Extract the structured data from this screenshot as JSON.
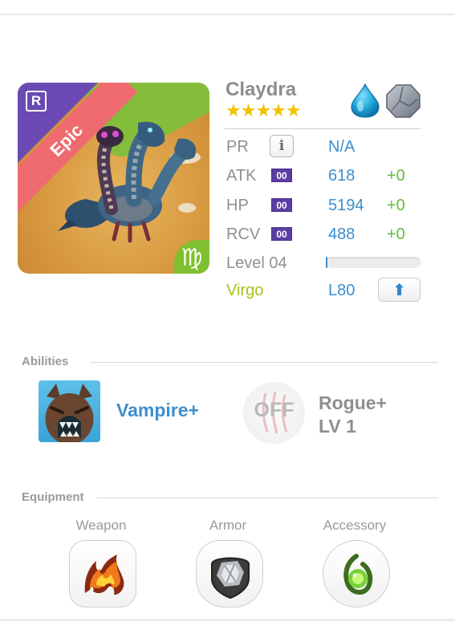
{
  "monster": {
    "name": "Claydra",
    "rarity": "Epic",
    "rarity_icon": "R",
    "stars": "★★★★★",
    "star_count": 5,
    "zodiac_symbol": "♍",
    "element_icons": [
      "water-drop-icon",
      "stone-icon"
    ]
  },
  "stats": {
    "pr": {
      "label": "PR",
      "info": "i",
      "value": "N/A"
    },
    "atk": {
      "label": "ATK",
      "badge": "00",
      "value": "618",
      "bonus": "+0"
    },
    "hp": {
      "label": "HP",
      "badge": "00",
      "value": "5194",
      "bonus": "+0"
    },
    "rcv": {
      "label": "RCV",
      "badge": "00",
      "value": "488",
      "bonus": "+0"
    },
    "level": {
      "label": "Level 04",
      "progress": 0.02
    },
    "zodiac": {
      "label": "Virgo",
      "limit": "L80",
      "upgrade_icon": "up-arrow-icon"
    }
  },
  "abilities": {
    "title": "Abilities",
    "items": [
      {
        "name": "Vampire+",
        "icon": "werewolf-icon"
      },
      {
        "name_line1": "Rogue+",
        "name_line2": "LV 1",
        "status": "OFF",
        "icon": "claw-icon"
      }
    ]
  },
  "equipment": {
    "title": "Equipment",
    "slots": [
      {
        "label": "Weapon",
        "icon": "fire-claw-icon"
      },
      {
        "label": "Armor",
        "icon": "armor-stone-icon"
      },
      {
        "label": "Accessory",
        "icon": "green-gem-icon"
      }
    ]
  },
  "colors": {
    "rarity_ribbon": "#ef6b6f",
    "rarity_corner": "#6b4bb3",
    "value_blue": "#3a8ed0",
    "bonus_green": "#5ebd3b",
    "zodiac_green": "#a3c41a",
    "star_yellow": "#f2c200"
  }
}
